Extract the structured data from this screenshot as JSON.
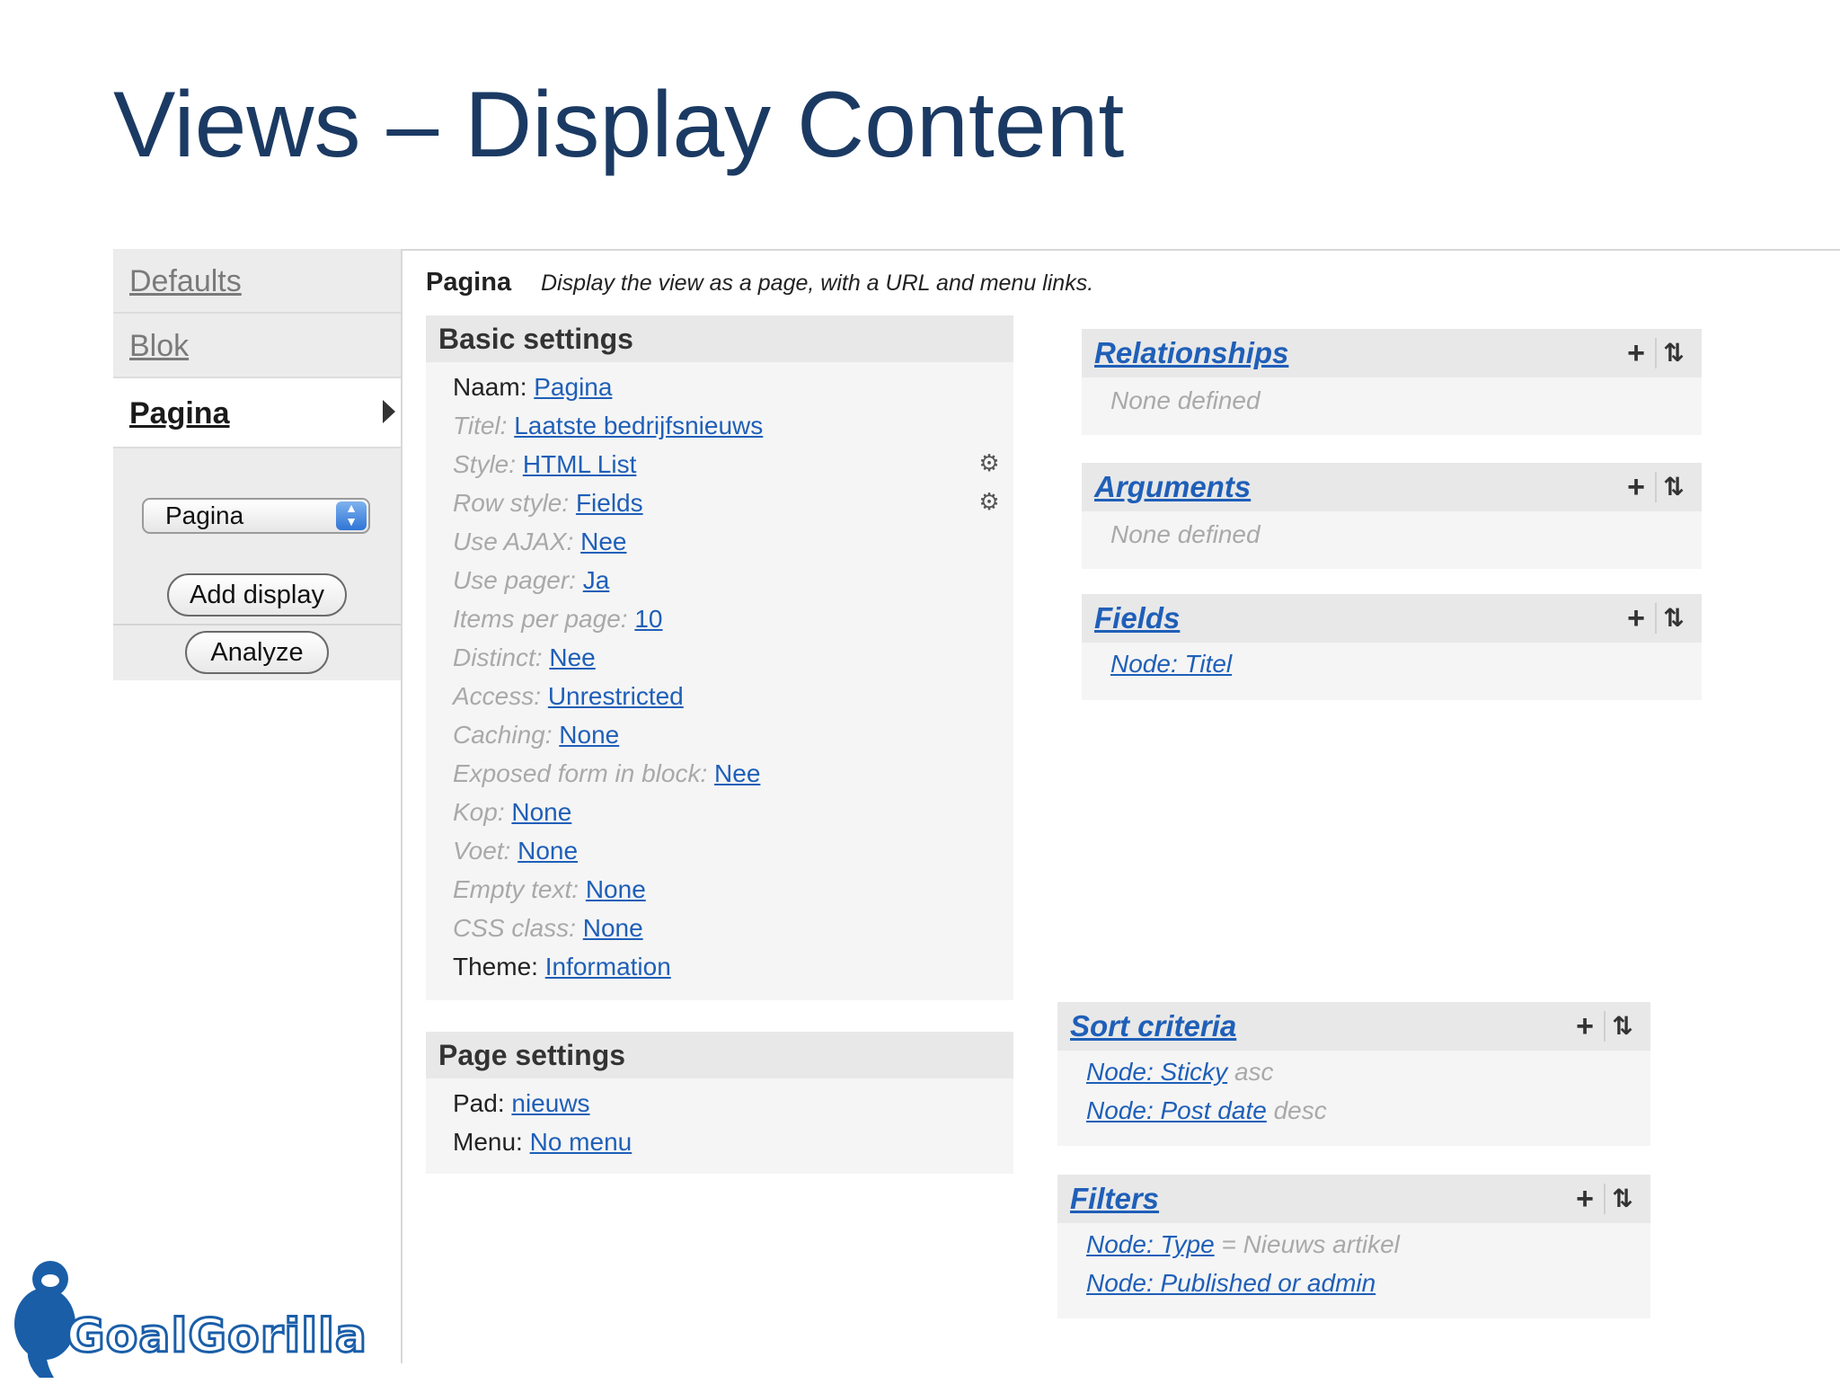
{
  "slide": {
    "title": "Views – Display Content"
  },
  "sidebar": {
    "tabs": [
      {
        "label": "Defaults"
      },
      {
        "label": "Blok"
      },
      {
        "label": "Pagina"
      }
    ],
    "select_value": "Pagina",
    "add_display_label": "Add display",
    "analyze_label": "Analyze"
  },
  "display": {
    "name": "Pagina",
    "description": "Display the view as a page, with a URL and menu links."
  },
  "basic_settings": {
    "title": "Basic settings",
    "rows": [
      {
        "label": "Naam:",
        "value": "Pagina"
      },
      {
        "label": "Titel:",
        "value": "Laatste bedrijfsnieuws"
      },
      {
        "label": "Style:",
        "value": "HTML List"
      },
      {
        "label": "Row style:",
        "value": "Fields"
      },
      {
        "label": "Use AJAX:",
        "value": "Nee"
      },
      {
        "label": "Use pager:",
        "value": "Ja"
      },
      {
        "label": "Items per page:",
        "value": "10"
      },
      {
        "label": "Distinct:",
        "value": "Nee"
      },
      {
        "label": "Access:",
        "value": "Unrestricted"
      },
      {
        "label": "Caching:",
        "value": "None"
      },
      {
        "label": "Exposed form in block:",
        "value": "Nee"
      },
      {
        "label": "Kop:",
        "value": "None"
      },
      {
        "label": "Voet:",
        "value": "None"
      },
      {
        "label": "Empty text:",
        "value": "None"
      },
      {
        "label": "CSS class:",
        "value": "None"
      },
      {
        "label": "Theme:",
        "value": "Information"
      }
    ]
  },
  "page_settings": {
    "title": "Page settings",
    "rows": [
      {
        "label": "Pad:",
        "value": "nieuws"
      },
      {
        "label": "Menu:",
        "value": "No menu"
      }
    ]
  },
  "relationships": {
    "title": "Relationships",
    "empty": "None defined"
  },
  "arguments": {
    "title": "Arguments",
    "empty": "None defined"
  },
  "fields": {
    "title": "Fields",
    "items": [
      {
        "link": "Node: Titel"
      }
    ]
  },
  "sort_criteria": {
    "title": "Sort criteria",
    "items": [
      {
        "link": "Node: Sticky",
        "suffix": "asc"
      },
      {
        "link": "Node: Post date",
        "suffix": "desc"
      }
    ]
  },
  "filters": {
    "title": "Filters",
    "items": [
      {
        "link": "Node: Type",
        "suffix": "= Nieuws artikel"
      },
      {
        "link": "Node: Published or admin",
        "suffix": ""
      }
    ]
  },
  "icons": {
    "add": "+",
    "rearrange": "⇅",
    "gear": "⚙"
  },
  "logo": {
    "text": "GoalGorilla"
  },
  "colors": {
    "title": "#1b3a63",
    "link": "#1f5fb8",
    "muted": "#a9a9a9"
  }
}
